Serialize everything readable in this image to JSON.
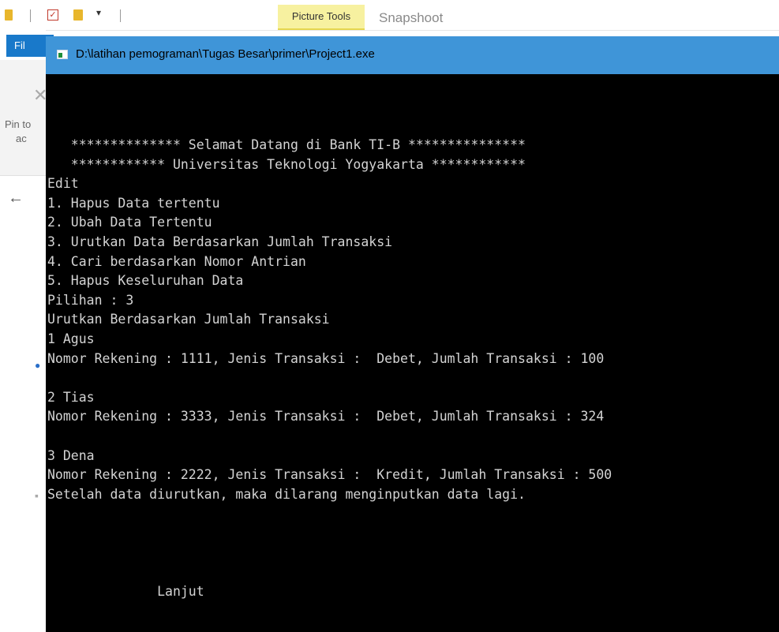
{
  "explorer": {
    "ribbon_tab_picture_tools": "Picture Tools",
    "ribbon_tab_snapshoot": "Snapshoot",
    "file_tab_label": "Fil",
    "pin_label_line1": "Pin to",
    "pin_label_line2": "ac",
    "qa_arrow": "▾",
    "back_arrow": "←"
  },
  "console": {
    "title": "D:\\latihan pemograman\\Tugas Besar\\primer\\Project1.exe",
    "lines": [
      "   ************** Selamat Datang di Bank TI-B ***************",
      "   ************ Universitas Teknologi Yogyakarta ************",
      "Edit",
      "1. Hapus Data tertentu",
      "2. Ubah Data Tertentu",
      "3. Urutkan Data Berdasarkan Jumlah Transaksi",
      "4. Cari berdasarkan Nomor Antrian",
      "5. Hapus Keseluruhan Data",
      "Pilihan : 3",
      "Urutkan Berdasarkan Jumlah Transaksi",
      "1 Agus",
      "Nomor Rekening : 1111, Jenis Transaksi :  Debet, Jumlah Transaksi : 100",
      "",
      "2 Tias",
      "Nomor Rekening : 3333, Jenis Transaksi :  Debet, Jumlah Transaksi : 324",
      "",
      "3 Dena",
      "Nomor Rekening : 2222, Jenis Transaksi :  Kredit, Jumlah Transaksi : 500",
      "Setelah data diurutkan, maka dilarang menginputkan data lagi.",
      "",
      "",
      "",
      "",
      "              Lanjut"
    ]
  }
}
